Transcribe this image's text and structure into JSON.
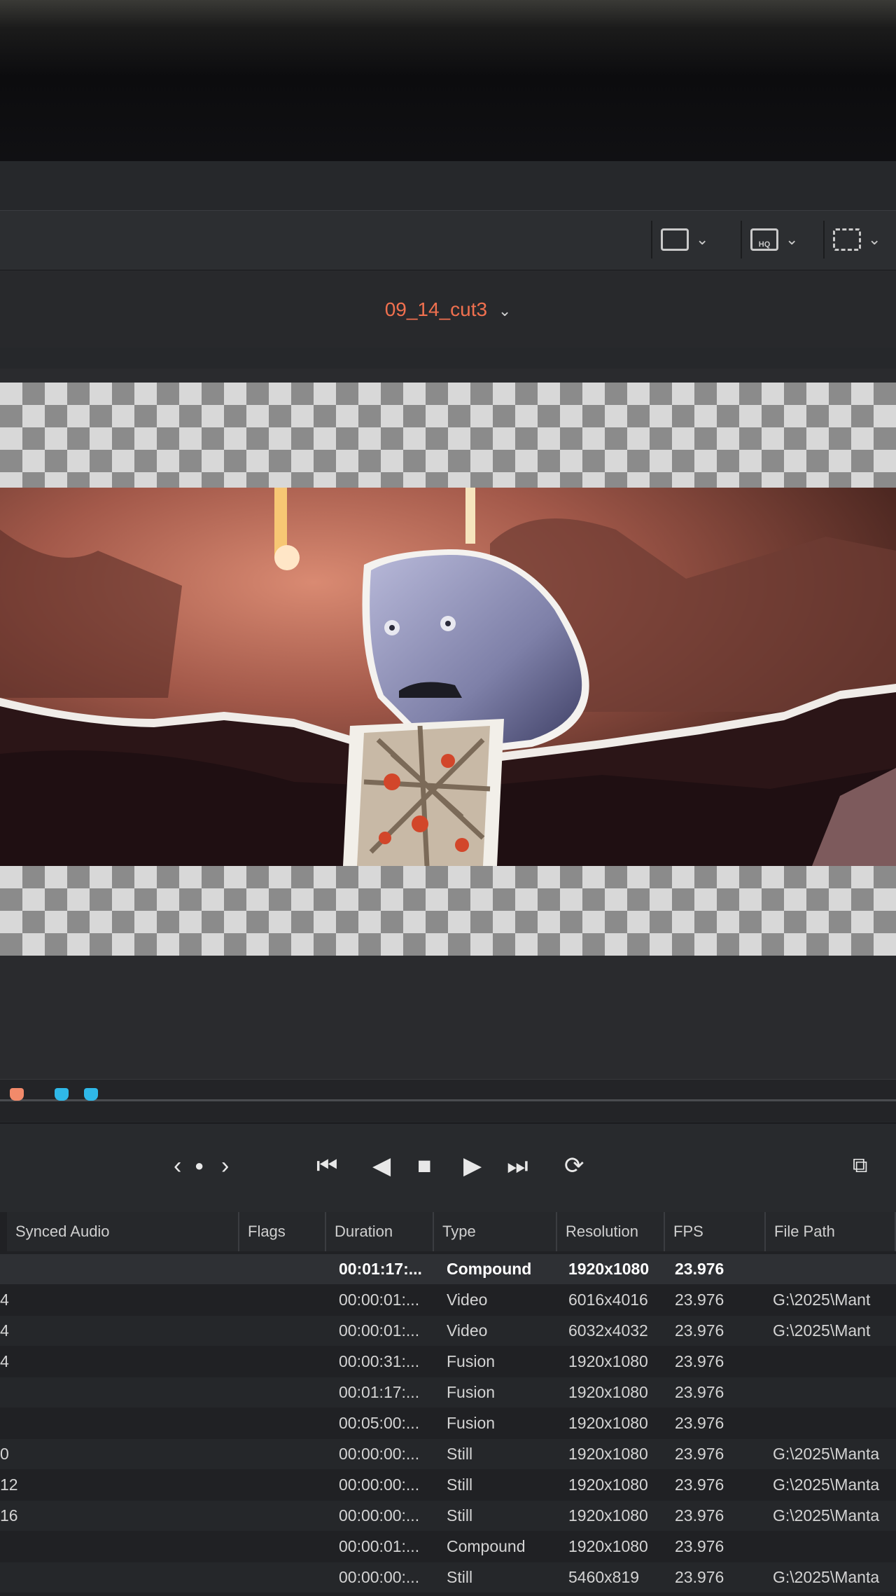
{
  "viewer": {
    "timeline_name": "09_14_cut3",
    "toolbar": {
      "hq_label": "HQ"
    }
  },
  "transport": {
    "prev_edit": "‹",
    "next_edit": "›",
    "skip_back": "⏮",
    "play_reverse": "◀",
    "stop": "■",
    "play": "▶",
    "skip_forward": "⏭",
    "loop": "⟳",
    "markers": [
      {
        "color": "#f28a6a"
      },
      {
        "color": "#2fb8e8"
      },
      {
        "color": "#2fb8e8"
      }
    ]
  },
  "media_list": {
    "columns": [
      "Synced Audio",
      "Flags",
      "Duration",
      "Type",
      "Resolution",
      "FPS",
      "File Path"
    ],
    "rows": [
      {
        "index": "",
        "duration": "00:01:17:...",
        "type": "Compound",
        "resolution": "1920x1080",
        "fps": "23.976",
        "path": ""
      },
      {
        "index": "4",
        "duration": "00:00:01:...",
        "type": "Video",
        "resolution": "6016x4016",
        "fps": "23.976",
        "path": "G:\\2025\\Mant"
      },
      {
        "index": "4",
        "duration": "00:00:01:...",
        "type": "Video",
        "resolution": "6032x4032",
        "fps": "23.976",
        "path": "G:\\2025\\Mant"
      },
      {
        "index": "4",
        "duration": "00:00:31:...",
        "type": "Fusion",
        "resolution": "1920x1080",
        "fps": "23.976",
        "path": ""
      },
      {
        "index": "",
        "duration": "00:01:17:...",
        "type": "Fusion",
        "resolution": "1920x1080",
        "fps": "23.976",
        "path": ""
      },
      {
        "index": "",
        "duration": "00:05:00:...",
        "type": "Fusion",
        "resolution": "1920x1080",
        "fps": "23.976",
        "path": ""
      },
      {
        "index": "0",
        "duration": "00:00:00:...",
        "type": "Still",
        "resolution": "1920x1080",
        "fps": "23.976",
        "path": "G:\\2025\\Manta"
      },
      {
        "index": "12",
        "duration": "00:00:00:...",
        "type": "Still",
        "resolution": "1920x1080",
        "fps": "23.976",
        "path": "G:\\2025\\Manta"
      },
      {
        "index": "16",
        "duration": "00:00:00:...",
        "type": "Still",
        "resolution": "1920x1080",
        "fps": "23.976",
        "path": "G:\\2025\\Manta"
      },
      {
        "index": "",
        "duration": "00:00:01:...",
        "type": "Compound",
        "resolution": "1920x1080",
        "fps": "23.976",
        "path": ""
      },
      {
        "index": "",
        "duration": "00:00:00:...",
        "type": "Still",
        "resolution": "5460x819",
        "fps": "23.976",
        "path": "G:\\2025\\Manta"
      }
    ]
  }
}
